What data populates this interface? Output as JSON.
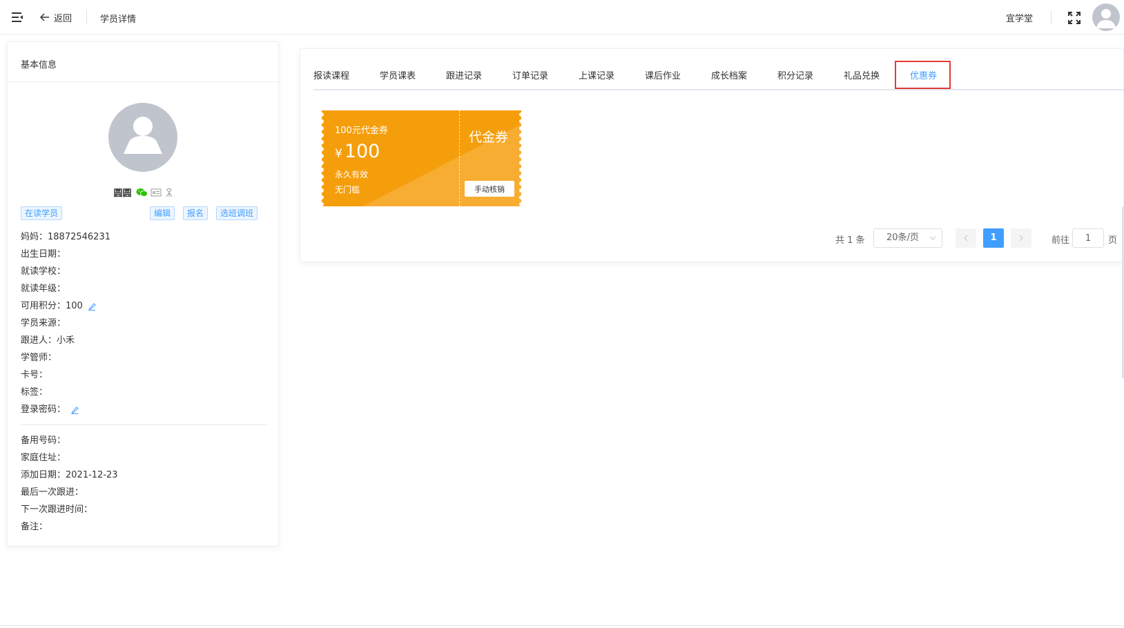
{
  "header": {
    "back_label": "返回",
    "page_title": "学员详情",
    "org_name": "宜学堂"
  },
  "student": {
    "card_title": "基本信息",
    "name": "圆圆",
    "tags": {
      "status": "在读学员",
      "edit": "编辑",
      "enroll": "报名",
      "class_change": "选班调班"
    },
    "info": [
      "妈妈：18872546231",
      "出生日期：",
      "就读学校：",
      "就读年级：",
      "可用积分：100",
      "学员来源：",
      "跟进人：小禾",
      "学管师：",
      "卡号：",
      "标签：",
      "登录密码："
    ],
    "extra": [
      "备用号码：",
      "家庭住址：",
      "添加日期：2021-12-23",
      "最后一次跟进：",
      "下一次跟进时间：",
      "备注："
    ]
  },
  "tabs": [
    {
      "label": "报读课程"
    },
    {
      "label": "学员课表"
    },
    {
      "label": "跟进记录"
    },
    {
      "label": "订单记录"
    },
    {
      "label": "上课记录"
    },
    {
      "label": "课后作业"
    },
    {
      "label": "成长档案"
    },
    {
      "label": "积分记录"
    },
    {
      "label": "礼品兑换"
    },
    {
      "label": "优惠券"
    }
  ],
  "active_tab": "优惠券",
  "coupon": {
    "title": "100元代金券",
    "currency": "¥",
    "amount": "100",
    "validity": "永久有效",
    "threshold": "无门槛",
    "type": "代金券",
    "action": "手动核销",
    "color": "#f59e0b"
  },
  "pagination": {
    "total_text": "共 1 条",
    "page_size": "20条/页",
    "current_page": "1",
    "goto_label": "前往",
    "goto_value": "1",
    "page_unit": "页"
  },
  "colors": {
    "primary": "#409eff",
    "highlight_border": "#e53935",
    "coupon": "#f59e0b"
  }
}
